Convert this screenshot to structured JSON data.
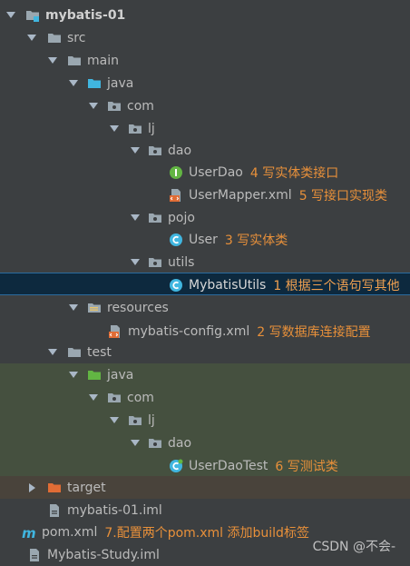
{
  "project": {
    "name": "mybatis-01",
    "sibling": "Mybatis-Study.iml"
  },
  "tree": [
    {
      "id": "mybatis-01",
      "label": "mybatis-01",
      "icon": "module-folder-icon",
      "expanded": true,
      "bold": true
    },
    {
      "id": "src",
      "label": "src",
      "icon": "folder-icon",
      "expanded": true
    },
    {
      "id": "main",
      "label": "main",
      "icon": "folder-icon",
      "expanded": true
    },
    {
      "id": "java-main",
      "label": "java",
      "icon": "source-folder-icon",
      "expanded": true
    },
    {
      "id": "com-main",
      "label": "com",
      "icon": "package-icon",
      "expanded": true
    },
    {
      "id": "lj-main",
      "label": "lj",
      "icon": "package-icon",
      "expanded": true
    },
    {
      "id": "dao-main",
      "label": "dao",
      "icon": "package-icon",
      "expanded": true
    },
    {
      "id": "userdao",
      "label": "UserDao",
      "icon": "interface-icon",
      "note": "4 写实体类接口"
    },
    {
      "id": "usermapper",
      "label": "UserMapper.xml",
      "icon": "xml-file-icon",
      "note": "5 写接口实现类"
    },
    {
      "id": "pojo",
      "label": "pojo",
      "icon": "package-icon",
      "expanded": true
    },
    {
      "id": "user",
      "label": "User",
      "icon": "class-icon",
      "note": "3 写实体类"
    },
    {
      "id": "utils",
      "label": "utils",
      "icon": "package-icon",
      "expanded": true
    },
    {
      "id": "mybatisutils",
      "label": "MybatisUtils",
      "icon": "class-icon",
      "note": "1 根据三个语句写其他",
      "selected": true
    },
    {
      "id": "resources",
      "label": "resources",
      "icon": "resources-folder-icon",
      "expanded": true
    },
    {
      "id": "mybatis-config",
      "label": "mybatis-config.xml",
      "icon": "xml-file-icon",
      "note": "2 写数据库连接配置"
    },
    {
      "id": "test",
      "label": "test",
      "icon": "folder-icon",
      "expanded": true
    },
    {
      "id": "java-test",
      "label": "java",
      "icon": "test-source-folder-icon",
      "expanded": true
    },
    {
      "id": "com-test",
      "label": "com",
      "icon": "package-icon",
      "expanded": true
    },
    {
      "id": "lj-test",
      "label": "lj",
      "icon": "package-icon",
      "expanded": true
    },
    {
      "id": "dao-test",
      "label": "dao",
      "icon": "package-icon",
      "expanded": true
    },
    {
      "id": "userdaotest",
      "label": "UserDaoTest",
      "icon": "test-class-icon",
      "note": "6 写测试类"
    },
    {
      "id": "target",
      "label": "target",
      "icon": "excluded-folder-icon",
      "expanded": false
    },
    {
      "id": "mybatis-iml",
      "label": "mybatis-01.iml",
      "icon": "iml-file-icon"
    },
    {
      "id": "pom",
      "label": "pom.xml",
      "icon": "maven-icon",
      "note": "7.配置两个pom.xml  添加build标签"
    },
    {
      "id": "study-iml",
      "label": "Mybatis-Study.iml",
      "icon": "iml-file-icon"
    }
  ],
  "watermark": "CSDN @不会-",
  "colors": {
    "background": "#3c3f41",
    "selection": "#0d293e",
    "test_highlight": "#45503f",
    "excluded_highlight": "#49433b",
    "annotation": "#e8903a",
    "text": "#bbbbbb"
  }
}
